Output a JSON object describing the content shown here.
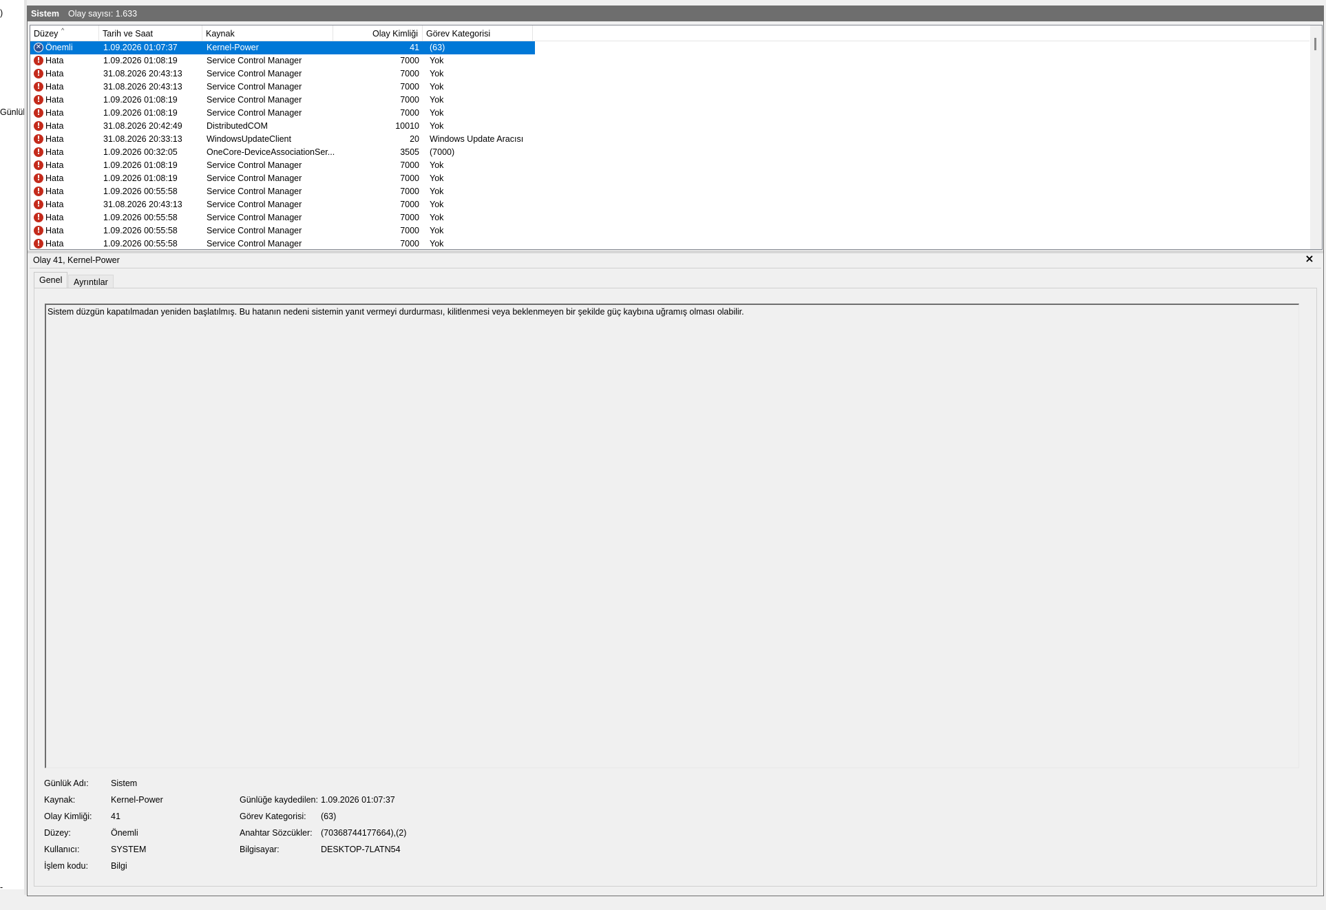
{
  "left_pane": {
    "fragments": [
      ")",
      "Günlük",
      "-"
    ]
  },
  "header": {
    "title": "Sistem",
    "event_count": "Olay sayısı: 1.633"
  },
  "columns": {
    "level": "Düzey",
    "date": "Tarih ve Saat",
    "source": "Kaynak",
    "event_id": "Olay Kimliği",
    "category": "Görev Kategorisi",
    "sort_glyph": "^"
  },
  "events": [
    {
      "level": "Önemli",
      "date": "1.09.2026 01:07:37",
      "source": "Kernel-Power",
      "id": "41",
      "category": "(63)",
      "icon": "critical-icon",
      "selected": true
    },
    {
      "level": "Hata",
      "date": "1.09.2026 01:08:19",
      "source": "Service Control Manager",
      "id": "7000",
      "category": "Yok",
      "icon": "error-icon"
    },
    {
      "level": "Hata",
      "date": "31.08.2026 20:43:13",
      "source": "Service Control Manager",
      "id": "7000",
      "category": "Yok",
      "icon": "error-icon"
    },
    {
      "level": "Hata",
      "date": "31.08.2026 20:43:13",
      "source": "Service Control Manager",
      "id": "7000",
      "category": "Yok",
      "icon": "error-icon"
    },
    {
      "level": "Hata",
      "date": "1.09.2026 01:08:19",
      "source": "Service Control Manager",
      "id": "7000",
      "category": "Yok",
      "icon": "error-icon"
    },
    {
      "level": "Hata",
      "date": "1.09.2026 01:08:19",
      "source": "Service Control Manager",
      "id": "7000",
      "category": "Yok",
      "icon": "error-icon"
    },
    {
      "level": "Hata",
      "date": "31.08.2026 20:42:49",
      "source": "DistributedCOM",
      "id": "10010",
      "category": "Yok",
      "icon": "error-icon"
    },
    {
      "level": "Hata",
      "date": "31.08.2026 20:33:13",
      "source": "WindowsUpdateClient",
      "id": "20",
      "category": "Windows Update Aracısı",
      "icon": "error-icon"
    },
    {
      "level": "Hata",
      "date": "1.09.2026 00:32:05",
      "source": "OneCore-DeviceAssociationSer...",
      "id": "3505",
      "category": "(7000)",
      "icon": "error-icon"
    },
    {
      "level": "Hata",
      "date": "1.09.2026 01:08:19",
      "source": "Service Control Manager",
      "id": "7000",
      "category": "Yok",
      "icon": "error-icon"
    },
    {
      "level": "Hata",
      "date": "1.09.2026 01:08:19",
      "source": "Service Control Manager",
      "id": "7000",
      "category": "Yok",
      "icon": "error-icon"
    },
    {
      "level": "Hata",
      "date": "1.09.2026 00:55:58",
      "source": "Service Control Manager",
      "id": "7000",
      "category": "Yok",
      "icon": "error-icon"
    },
    {
      "level": "Hata",
      "date": "31.08.2026 20:43:13",
      "source": "Service Control Manager",
      "id": "7000",
      "category": "Yok",
      "icon": "error-icon"
    },
    {
      "level": "Hata",
      "date": "1.09.2026 00:55:58",
      "source": "Service Control Manager",
      "id": "7000",
      "category": "Yok",
      "icon": "error-icon"
    },
    {
      "level": "Hata",
      "date": "1.09.2026 00:55:58",
      "source": "Service Control Manager",
      "id": "7000",
      "category": "Yok",
      "icon": "error-icon"
    },
    {
      "level": "Hata",
      "date": "1.09.2026 00:55:58",
      "source": "Service Control Manager",
      "id": "7000",
      "category": "Yok",
      "icon": "error-icon"
    }
  ],
  "detail": {
    "title": "Olay 41, Kernel-Power",
    "close_glyph": "×",
    "tabs": [
      "Genel",
      "Ayrıntılar"
    ],
    "description": "Sistem düzgün kapatılmadan yeniden başlatılmış. Bu hatanın nedeni sistemin yanıt vermeyi durdurması, kilitlenmesi veya beklenmeyen bir şekilde güç kaybına uğramış olması olabilir.",
    "properties_left": [
      {
        "label": "Günlük Adı:",
        "value": "Sistem"
      },
      {
        "label": "Kaynak:",
        "value": "Kernel-Power"
      },
      {
        "label": "Olay Kimliği:",
        "value": "41"
      },
      {
        "label": "Düzey:",
        "value": "Önemli"
      },
      {
        "label": "Kullanıcı:",
        "value": "SYSTEM"
      },
      {
        "label": "İşlem kodu:",
        "value": "Bilgi"
      }
    ],
    "properties_right": [
      {
        "label": "Günlüğe kaydedilen:",
        "value": "1.09.2026 01:07:37"
      },
      {
        "label": "Görev Kategorisi:",
        "value": "(63)"
      },
      {
        "label": "Anahtar Sözcükler:",
        "value": "(70368744177664),(2)"
      },
      {
        "label": "Bilgisayar:",
        "value": "DESKTOP-7LATN54"
      }
    ]
  },
  "colors": {
    "selection": "#0078d7",
    "header_bar": "#6e6e6e",
    "error_icon": "#c42b1c"
  }
}
